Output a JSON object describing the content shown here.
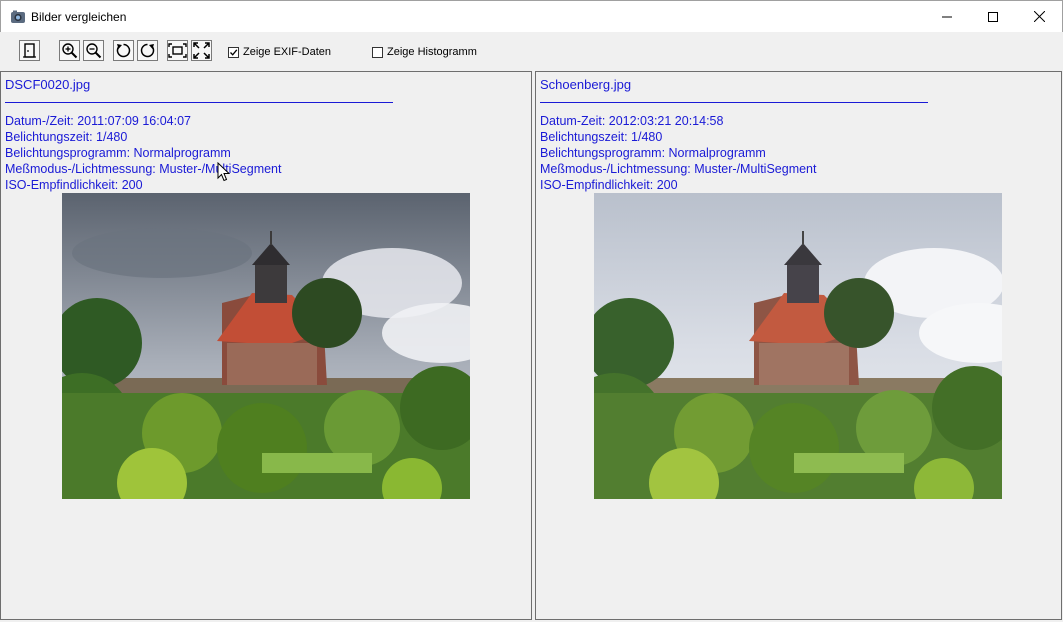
{
  "window": {
    "title": "Bilder vergleichen",
    "controls": [
      "minimize",
      "maximize",
      "close"
    ]
  },
  "toolbar": {
    "buttons": [
      {
        "icon": "exit-door-icon"
      },
      {
        "icon": "zoom-in-icon"
      },
      {
        "icon": "zoom-out-icon"
      },
      {
        "icon": "rotate-left-icon"
      },
      {
        "icon": "rotate-right-icon"
      },
      {
        "icon": "fit-to-window-icon"
      },
      {
        "icon": "fullscreen-icon"
      }
    ],
    "show_exif": {
      "label": "Zeige EXIF-Daten",
      "checked": true
    },
    "show_histogram": {
      "label": "Zeige Histogramm",
      "checked": false
    }
  },
  "left": {
    "filename": "DSCF0020.jpg",
    "exif": [
      "Datum-/Zeit: 2011:07:09 16:04:07",
      "Belichtungszeit: 1/480",
      "Belichtungsprogramm: Normalprogramm",
      "Meßmodus-/Lichtmessung: Muster-/MultiSegment",
      "ISO-Empfindlichkeit: 200"
    ]
  },
  "right": {
    "filename": "Schoenberg.jpg",
    "exif": [
      "Datum-Zeit: 2012:03:21 20:14:58",
      "Belichtungszeit: 1/480",
      "Belichtungsprogramm: Normalprogramm",
      "Meßmodus-/Lichtmessung: Muster-/MultiSegment",
      "ISO-Empfindlichkeit: 200"
    ]
  },
  "colors": {
    "exif_text": "#1a1ad6",
    "background": "#f0f0f0"
  }
}
